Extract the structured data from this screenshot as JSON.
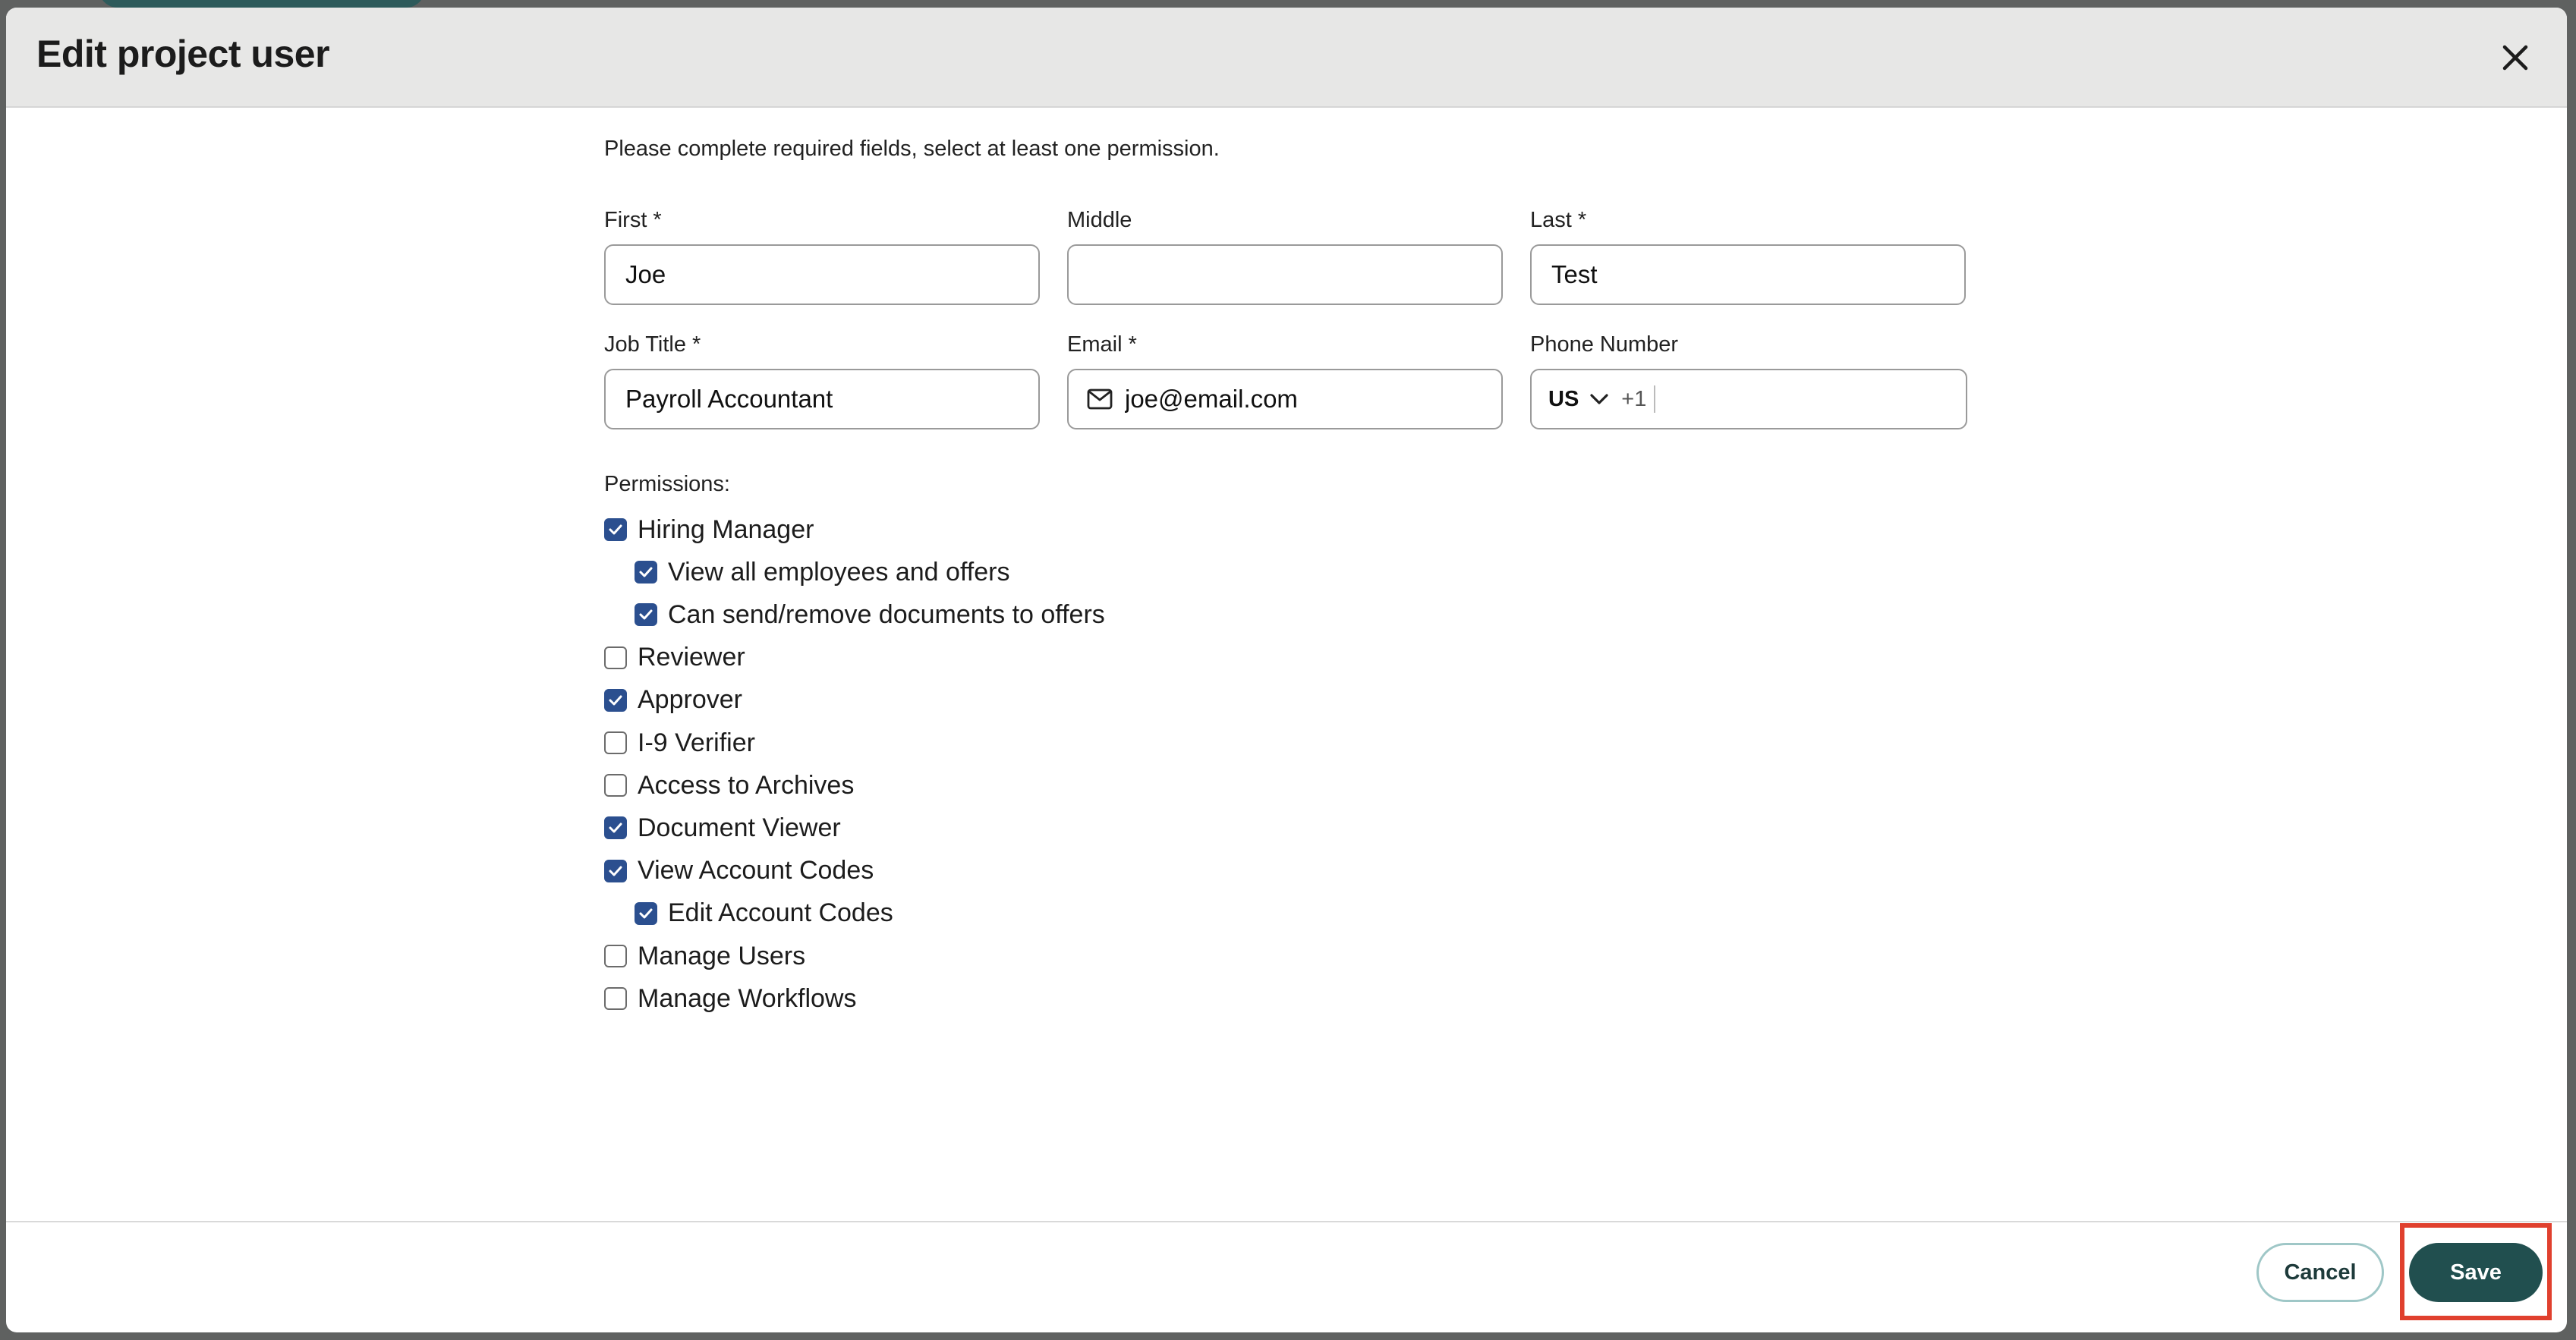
{
  "modal": {
    "title": "Edit project user",
    "instructions": "Please complete required fields, select at least one permission."
  },
  "fields": {
    "first_label": "First *",
    "first_value": "Joe",
    "middle_label": "Middle",
    "middle_value": "",
    "last_label": "Last *",
    "last_value": "Test",
    "job_title_label": "Job Title *",
    "job_title_value": "Payroll Accountant",
    "email_label": "Email *",
    "email_value": "joe@email.com",
    "phone_label": "Phone Number",
    "phone_country": "US",
    "phone_dial_code": "+1",
    "phone_value": ""
  },
  "permissions": {
    "label": "Permissions:",
    "items": [
      {
        "label": "Hiring Manager",
        "checked": true,
        "level": 0
      },
      {
        "label": "View all employees and offers",
        "checked": true,
        "level": 1
      },
      {
        "label": "Can send/remove documents to offers",
        "checked": true,
        "level": 1
      },
      {
        "label": "Reviewer",
        "checked": false,
        "level": 0
      },
      {
        "label": "Approver",
        "checked": true,
        "level": 0
      },
      {
        "label": "I-9 Verifier",
        "checked": false,
        "level": 0
      },
      {
        "label": "Access to Archives",
        "checked": false,
        "level": 0
      },
      {
        "label": "Document Viewer",
        "checked": true,
        "level": 0
      },
      {
        "label": "View Account Codes",
        "checked": true,
        "level": 0
      },
      {
        "label": "Edit Account Codes",
        "checked": true,
        "level": 1
      },
      {
        "label": "Manage Users",
        "checked": false,
        "level": 0
      },
      {
        "label": "Manage Workflows",
        "checked": false,
        "level": 0
      }
    ]
  },
  "footer": {
    "cancel_label": "Cancel",
    "save_label": "Save"
  },
  "colors": {
    "checkbox_checked": "#2b4f8f",
    "save_button": "#214f4f",
    "cancel_border": "#9fc7c7",
    "highlight": "#e0402e"
  }
}
